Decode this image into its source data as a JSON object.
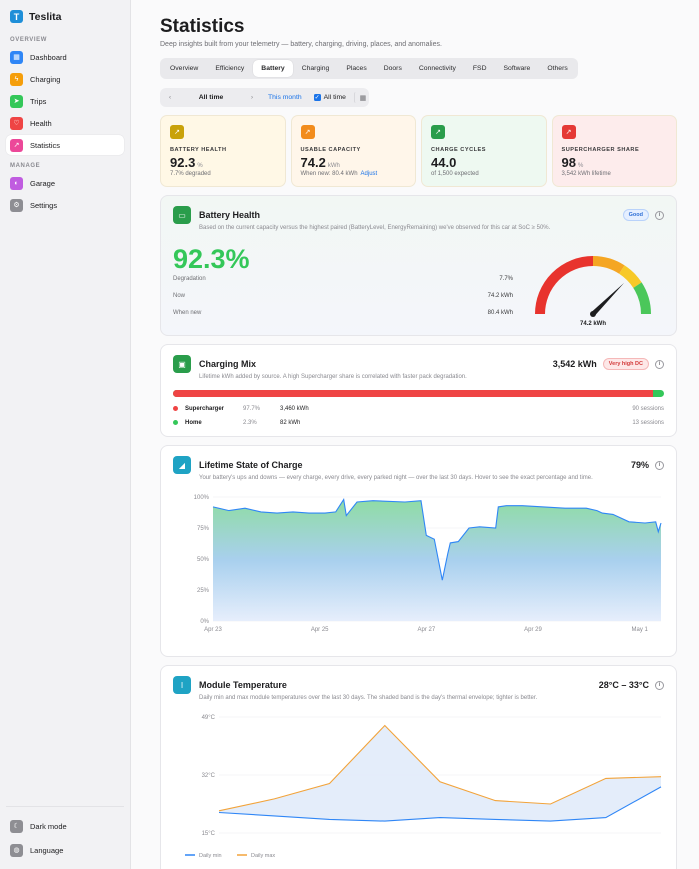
{
  "app": {
    "name": "Teslita"
  },
  "sidebar": {
    "overview_label": "OVERVIEW",
    "manage_label": "MANAGE",
    "overview_items": [
      {
        "label": "Dashboard",
        "icon": "grid-icon",
        "color": "#2f86f6"
      },
      {
        "label": "Charging",
        "icon": "bolt-icon",
        "color": "#f59e0b"
      },
      {
        "label": "Trips",
        "icon": "navigation-icon",
        "color": "#34c759"
      },
      {
        "label": "Health",
        "icon": "heart-icon",
        "color": "#ef4444"
      },
      {
        "label": "Statistics",
        "icon": "chart-icon",
        "color": "#ec4899"
      }
    ],
    "manage_items": [
      {
        "label": "Garage",
        "icon": "car-icon",
        "color": "#c05ce0"
      },
      {
        "label": "Settings",
        "icon": "gear-icon",
        "color": "#8e8e93"
      }
    ],
    "bottom_items": [
      {
        "label": "Dark mode",
        "icon": "moon-icon",
        "color": "#8e8e93"
      },
      {
        "label": "Language",
        "icon": "globe-icon",
        "color": "#8e8e93"
      }
    ]
  },
  "page": {
    "title": "Statistics",
    "subtitle": "Deep insights built from your telemetry — battery, charging, driving, places, and anomalies."
  },
  "tabs": [
    "Overview",
    "Efficiency",
    "Battery",
    "Charging",
    "Places",
    "Doors",
    "Connectivity",
    "FSD",
    "Software",
    "Others"
  ],
  "active_tab": "Battery",
  "range": {
    "prev": "‹",
    "period": "All time",
    "next": "›",
    "this_month": "This month",
    "all_time": "All time"
  },
  "stats": [
    {
      "label": "BATTERY HEALTH",
      "value": "92.3",
      "unit": "%",
      "sub": "7.7% degraded",
      "link": "",
      "bg": "#fff8e6",
      "icon_color": "#c9a20a"
    },
    {
      "label": "USABLE CAPACITY",
      "value": "74.2",
      "unit": "kWh",
      "sub": "When new: 80.4 kWh",
      "link": "Adjust",
      "bg": "#fff6ea",
      "icon_color": "#f28c1c"
    },
    {
      "label": "CHARGE CYCLES",
      "value": "44.0",
      "unit": "",
      "sub": "of 1,500 expected",
      "link": "",
      "bg": "#eef9f1",
      "icon_color": "#2a9d4b"
    },
    {
      "label": "SUPERCHARGER SHARE",
      "value": "98",
      "unit": "%",
      "sub": "3,542 kWh lifetime",
      "link": "",
      "bg": "#fdecec",
      "icon_color": "#e53935"
    }
  ],
  "battery_health": {
    "title": "Battery Health",
    "desc": "Based on the current capacity versus the highest paired (BatteryLevel, EnergyRemaining) we've observed for this car at SoC ≥ 50%.",
    "badge": "Good",
    "percent": "92.3%",
    "rows": [
      {
        "k": "Degradation",
        "v": "7.7%"
      },
      {
        "k": "Now",
        "v": "74.2 kWh"
      },
      {
        "k": "When new",
        "v": "80.4 kWh"
      }
    ],
    "gauge_label": "74.2 kWh",
    "gauge_fraction": 0.923
  },
  "charging_mix": {
    "title": "Charging Mix",
    "desc": "Lifetime kWh added by source. A high Supercharger share is correlated with faster pack degradation.",
    "total": "3,542 kWh",
    "badge": "Very high DC",
    "supercharger_fraction": 0.977,
    "sources": [
      {
        "name": "Supercharger",
        "pct": "97.7%",
        "kwh": "3,460 kWh",
        "sessions": "90 sessions",
        "color": "#ef4444"
      },
      {
        "name": "Home",
        "pct": "2.3%",
        "kwh": "82 kWh",
        "sessions": "13 sessions",
        "color": "#34c759"
      }
    ]
  },
  "soc": {
    "title": "Lifetime State of Charge",
    "desc": "Your battery's ups and downs — every charge, every drive, every parked night — over the last 30 days. Hover to see the exact percentage and time.",
    "current": "79%"
  },
  "temp": {
    "title": "Module Temperature",
    "desc": "Daily min and max module temperatures over the last 30 days. The shaded band is the day's thermal envelope; tighter is better.",
    "range": "28°C – 33°C",
    "legend_min": "Daily min",
    "legend_max": "Daily max"
  },
  "chart_data": [
    {
      "type": "area",
      "title": "Lifetime State of Charge",
      "x_ticks": [
        "Apr 23",
        "Apr 25",
        "Apr 27",
        "Apr 29",
        "May 1"
      ],
      "y_ticks": [
        "100%",
        "75%",
        "50%",
        "25%",
        "0%"
      ],
      "ylim": [
        0,
        100
      ],
      "xlim": [
        0,
        8.4
      ],
      "series": [
        {
          "x": [
            0,
            0.3,
            0.6,
            0.9,
            1.2,
            1.5,
            1.8,
            2.1,
            2.3,
            2.45,
            2.5,
            2.7,
            3.0,
            3.6,
            3.9,
            4.0,
            4.15,
            4.3,
            4.4,
            4.45,
            4.6,
            4.8,
            5.0,
            5.3,
            5.35,
            5.5,
            5.8,
            6.2,
            6.6,
            7.0,
            7.2,
            7.3,
            7.5,
            7.8,
            8.1,
            8.3,
            8.35,
            8.4
          ],
          "y": [
            92,
            89,
            91,
            88,
            87,
            88,
            87,
            87,
            88,
            98,
            85,
            96,
            97,
            96,
            97,
            69,
            66,
            33,
            54,
            63,
            64,
            75,
            76,
            75,
            92,
            93,
            93,
            92,
            91,
            91,
            89,
            87,
            86,
            80,
            79,
            80,
            72,
            79
          ]
        }
      ]
    },
    {
      "type": "line",
      "title": "Module Temperature",
      "x": [
        0,
        1,
        2,
        3,
        4,
        5,
        6,
        7,
        8
      ],
      "y_ticks": [
        "49°C",
        "32°C",
        "15°C"
      ],
      "ylim": [
        15,
        49
      ],
      "series": [
        {
          "name": "Daily min",
          "color": "#2f86f6",
          "values": [
            21,
            20,
            19,
            18.5,
            19.5,
            19,
            18.5,
            19.5,
            28.5
          ]
        },
        {
          "name": "Daily max",
          "color": "#f2a33a",
          "values": [
            21.5,
            25,
            29.5,
            46.5,
            30,
            24.5,
            23.5,
            31,
            31.5
          ]
        }
      ]
    }
  ]
}
